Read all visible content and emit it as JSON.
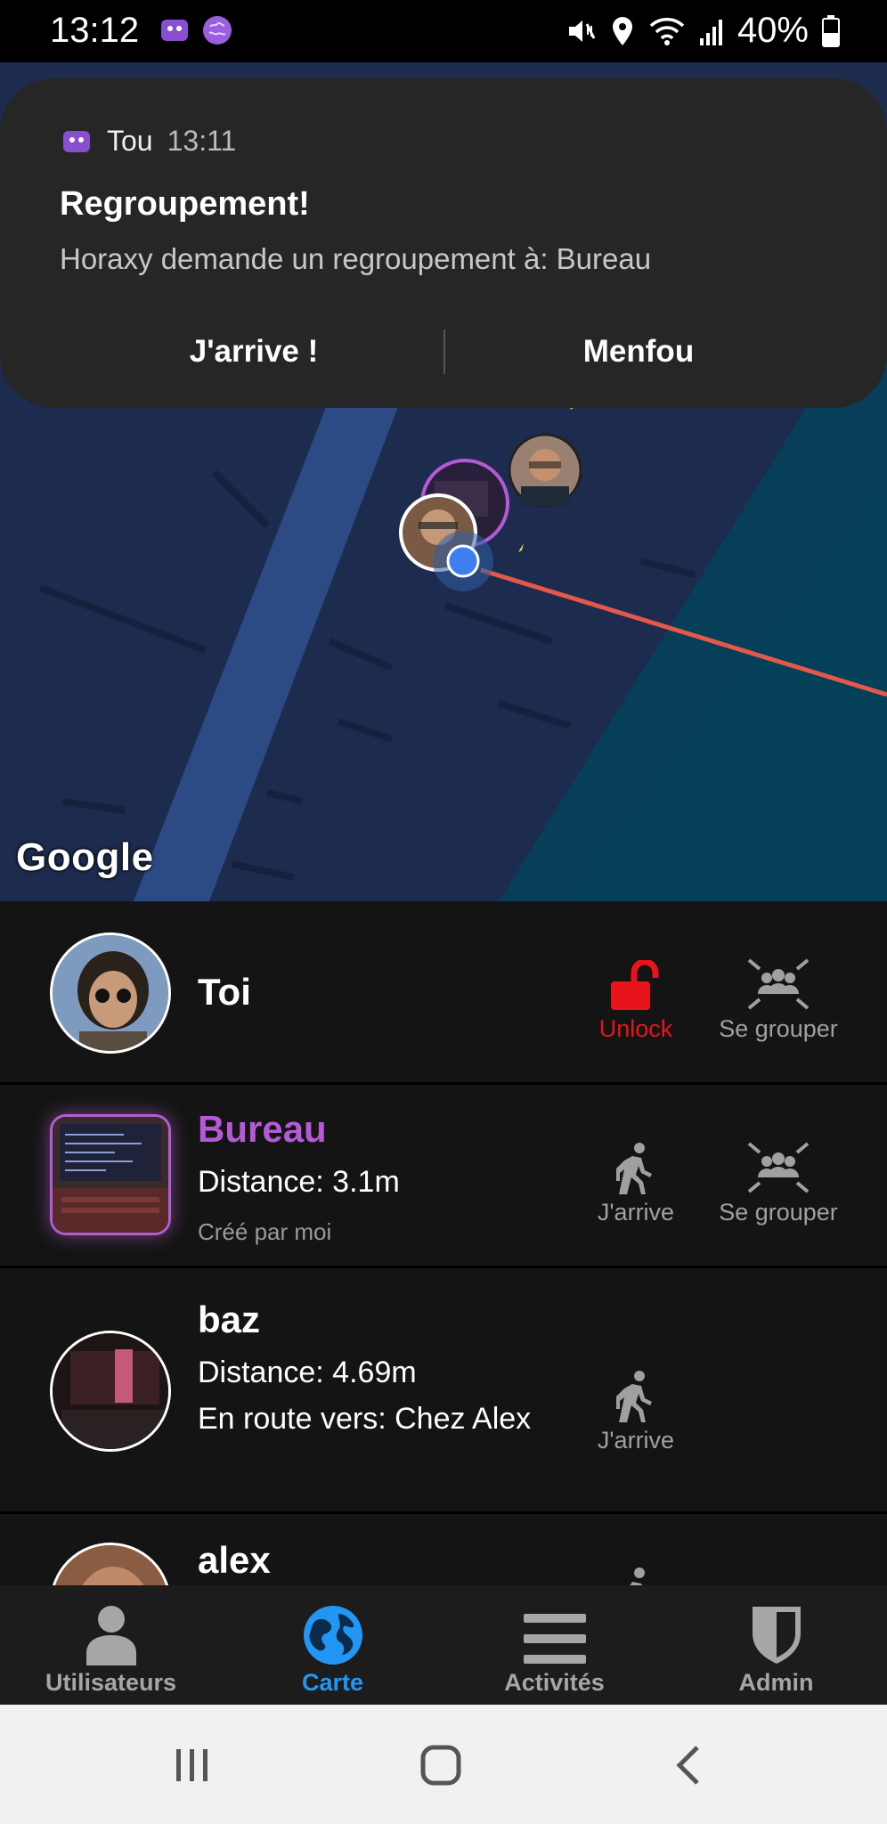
{
  "status_bar": {
    "time": "13:12",
    "battery": "40%",
    "icons": [
      "app-icon",
      "brain-icon",
      "mute-icon",
      "location-icon",
      "wifi-icon",
      "signal-icon",
      "battery-icon"
    ]
  },
  "notification": {
    "app_name": "Tou",
    "time": "13:11",
    "title": "Regroupement!",
    "body": "Horaxy demande un regroupement à: Bureau",
    "action_accept": "J'arrive !",
    "action_decline": "Menfou"
  },
  "map": {
    "logo": "Google"
  },
  "list": {
    "me": {
      "name": "Toi",
      "unlock_label": "Unlock",
      "group_label": "Se grouper"
    },
    "place": {
      "name": "Bureau",
      "distance": "Distance: 3.1m",
      "created_by": "Créé par moi",
      "arrive_label": "J'arrive",
      "group_label": "Se grouper"
    },
    "users": [
      {
        "name": "baz",
        "distance": "Distance: 4.69m",
        "route": "En route vers: Chez Alex",
        "arrive_label": "J'arrive"
      },
      {
        "name": "alex"
      }
    ]
  },
  "bottom_nav": {
    "items": [
      {
        "label": "Utilisateurs",
        "icon": "user-icon"
      },
      {
        "label": "Carte",
        "icon": "globe-icon"
      },
      {
        "label": "Activités",
        "icon": "menu-icon"
      },
      {
        "label": "Admin",
        "icon": "shield-icon"
      }
    ],
    "active": "Carte"
  },
  "colors": {
    "accent": "#2196f3",
    "place_purple": "#b55ad6",
    "unlock_red": "#e8141b",
    "route_line": "#e2584a"
  }
}
